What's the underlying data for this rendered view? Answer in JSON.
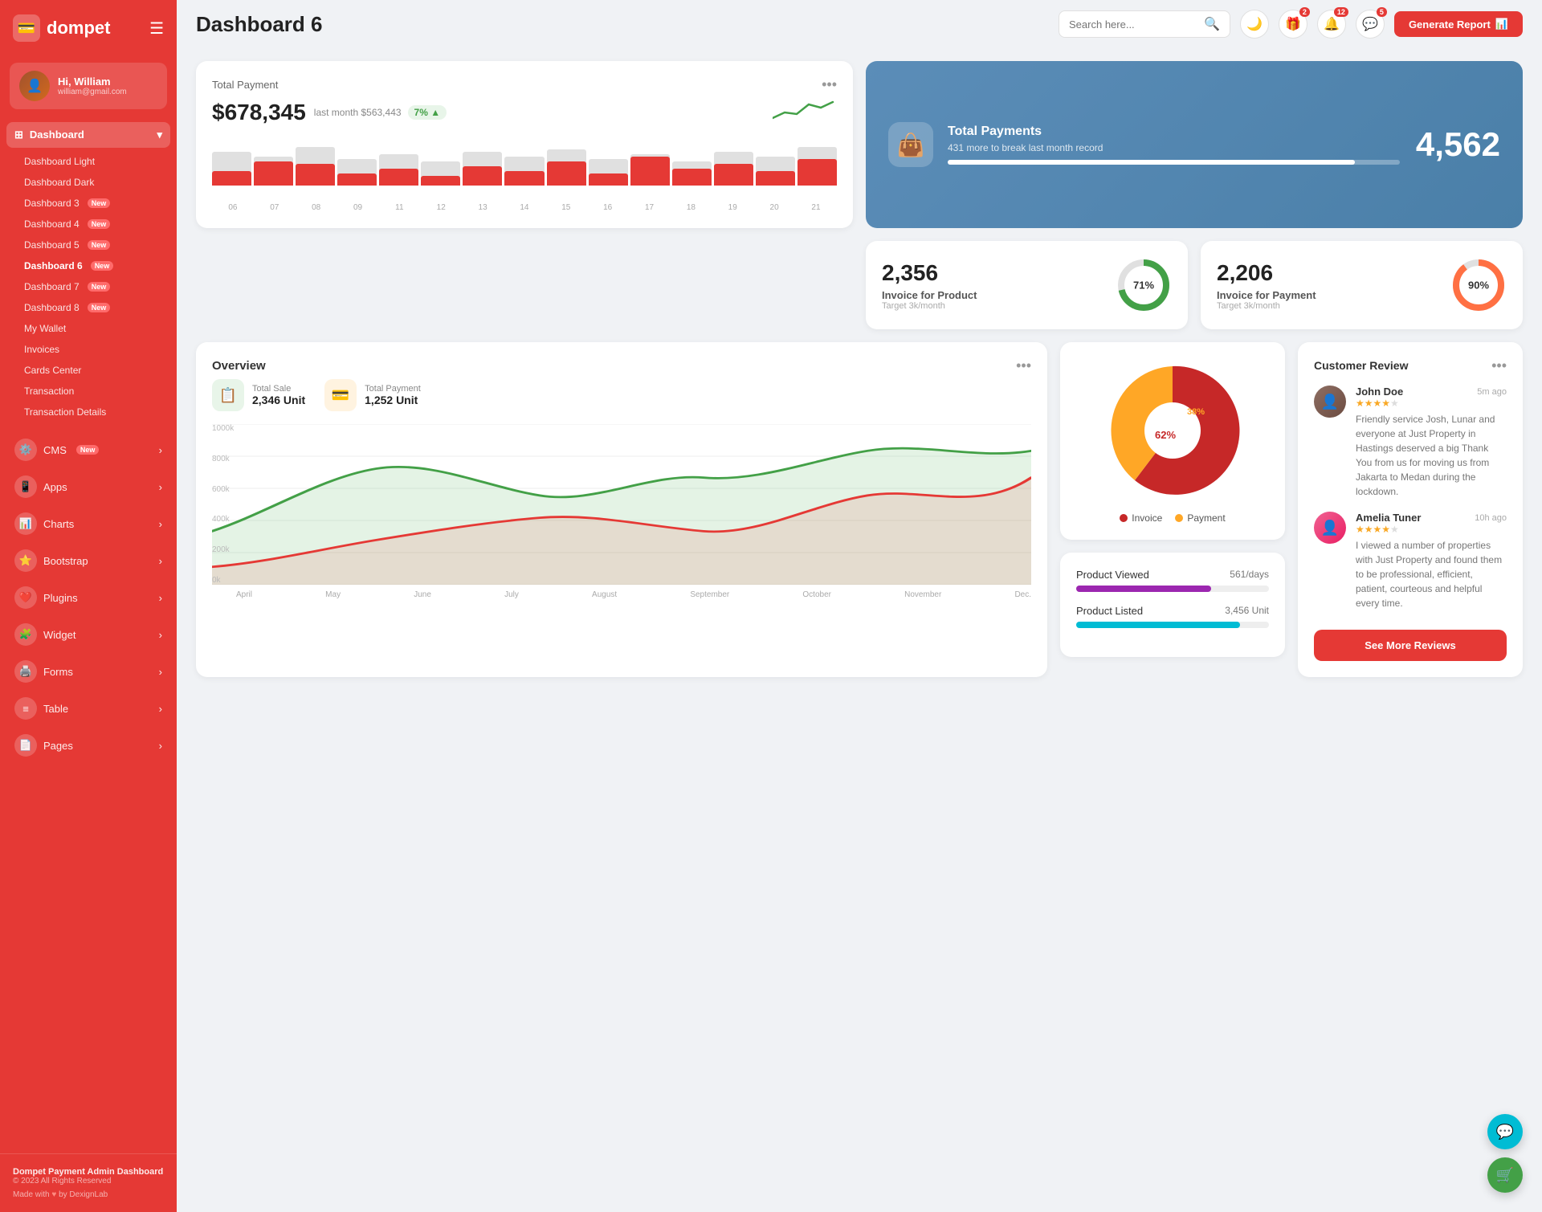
{
  "sidebar": {
    "logo": "dompet",
    "logo_icon": "💳",
    "user": {
      "greeting": "Hi, William",
      "email": "william@gmail.com"
    },
    "dashboard_group": "Dashboard",
    "nav_items": [
      {
        "label": "Dashboard Light",
        "new": false,
        "active": false
      },
      {
        "label": "Dashboard Dark",
        "new": false,
        "active": false
      },
      {
        "label": "Dashboard 3",
        "new": true,
        "active": false
      },
      {
        "label": "Dashboard 4",
        "new": true,
        "active": false
      },
      {
        "label": "Dashboard 5",
        "new": true,
        "active": false
      },
      {
        "label": "Dashboard 6",
        "new": true,
        "active": true
      },
      {
        "label": "Dashboard 7",
        "new": true,
        "active": false
      },
      {
        "label": "Dashboard 8",
        "new": true,
        "active": false
      },
      {
        "label": "My Wallet",
        "new": false,
        "active": false
      },
      {
        "label": "Invoices",
        "new": false,
        "active": false
      },
      {
        "label": "Cards Center",
        "new": false,
        "active": false
      },
      {
        "label": "Transaction",
        "new": false,
        "active": false
      },
      {
        "label": "Transaction Details",
        "new": false,
        "active": false
      }
    ],
    "menu_items": [
      {
        "label": "CMS",
        "new": true,
        "icon": "⚙️"
      },
      {
        "label": "Apps",
        "new": false,
        "icon": "📱"
      },
      {
        "label": "Charts",
        "new": false,
        "icon": "📊"
      },
      {
        "label": "Bootstrap",
        "new": false,
        "icon": "⭐"
      },
      {
        "label": "Plugins",
        "new": false,
        "icon": "❤️"
      },
      {
        "label": "Widget",
        "new": false,
        "icon": "🧩"
      },
      {
        "label": "Forms",
        "new": false,
        "icon": "🖨️"
      },
      {
        "label": "Table",
        "new": false,
        "icon": "≡"
      },
      {
        "label": "Pages",
        "new": false,
        "icon": "📄"
      }
    ],
    "footer": {
      "app_name": "Dompet Payment Admin Dashboard",
      "copyright": "© 2023 All Rights Reserved",
      "made_with": "Made with",
      "by": "by DexignLab"
    }
  },
  "topbar": {
    "page_title": "Dashboard 6",
    "search_placeholder": "Search here...",
    "notification_badges": {
      "gift": 2,
      "bell": 12,
      "message": 5
    },
    "generate_btn": "Generate Report"
  },
  "total_payment": {
    "title": "Total Payment",
    "amount": "$678,345",
    "last_month": "last month $563,443",
    "trend": "7%",
    "bars": [
      {
        "label": "06",
        "gray": 70,
        "red": 30
      },
      {
        "label": "07",
        "gray": 60,
        "red": 50
      },
      {
        "label": "08",
        "gray": 80,
        "red": 45
      },
      {
        "label": "09",
        "gray": 55,
        "red": 25
      },
      {
        "label": "11",
        "gray": 65,
        "red": 35
      },
      {
        "label": "12",
        "gray": 50,
        "red": 20
      },
      {
        "label": "13",
        "gray": 70,
        "red": 40
      },
      {
        "label": "14",
        "gray": 60,
        "red": 30
      },
      {
        "label": "15",
        "gray": 75,
        "red": 50
      },
      {
        "label": "16",
        "gray": 55,
        "red": 25
      },
      {
        "label": "17",
        "gray": 65,
        "red": 60
      },
      {
        "label": "18",
        "gray": 50,
        "red": 35
      },
      {
        "label": "19",
        "gray": 70,
        "red": 45
      },
      {
        "label": "20",
        "gray": 60,
        "red": 30
      },
      {
        "label": "21",
        "gray": 80,
        "red": 55
      }
    ]
  },
  "banner": {
    "title": "Total Payments",
    "subtitle": "431 more to break last month record",
    "number": "4,562"
  },
  "invoice_product": {
    "number": "2,356",
    "label": "Invoice for Product",
    "target": "Target 3k/month",
    "percent": 71,
    "color": "#43a047"
  },
  "invoice_payment": {
    "number": "2,206",
    "label": "Invoice for Payment",
    "target": "Target 3k/month",
    "percent": 90,
    "color": "#ff7043"
  },
  "overview": {
    "title": "Overview",
    "total_sale": {
      "label": "Total Sale",
      "value": "2,346 Unit"
    },
    "total_payment": {
      "label": "Total Payment",
      "value": "1,252 Unit"
    },
    "months": [
      "April",
      "May",
      "June",
      "July",
      "August",
      "September",
      "October",
      "November",
      "Dec."
    ],
    "y_labels": [
      "1000k",
      "800k",
      "600k",
      "400k",
      "200k",
      "0k"
    ]
  },
  "pie_chart": {
    "invoice_pct": 62,
    "payment_pct": 38,
    "invoice_color": "#c62828",
    "payment_color": "#ffa726",
    "invoice_label": "Invoice",
    "payment_label": "Payment"
  },
  "product_stats": {
    "viewed": {
      "label": "Product Viewed",
      "value": "561/days",
      "percent": 70,
      "color": "purple"
    },
    "listed": {
      "label": "Product Listed",
      "value": "3,456 Unit",
      "percent": 85,
      "color": "teal"
    }
  },
  "reviews": {
    "title": "Customer Review",
    "items": [
      {
        "name": "John Doe",
        "stars": 4,
        "time": "5m ago",
        "text": "Friendly service Josh, Lunar and everyone at Just Property in Hastings deserved a big Thank You from us for moving us from Jakarta to Medan during the lockdown."
      },
      {
        "name": "Amelia Tuner",
        "stars": 4,
        "time": "10h ago",
        "text": "I viewed a number of properties with Just Property and found them to be professional, efficient, patient, courteous and helpful every time."
      }
    ],
    "see_more": "See More Reviews"
  }
}
